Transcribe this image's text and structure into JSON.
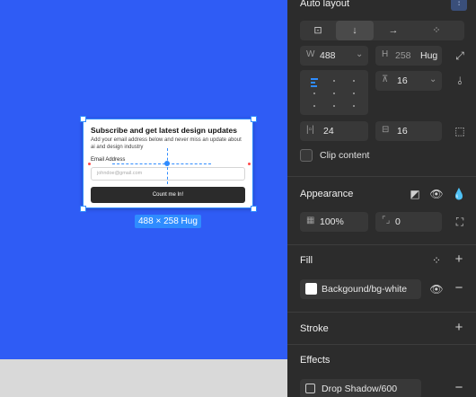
{
  "canvas": {
    "card": {
      "title": "Subscribe and get latest design updates",
      "description": "Add your email address below and never miss an update about ai and design industry",
      "email_label": "Email Address",
      "email_placeholder": "johndoe@gmail.com",
      "button_label": "Count me In!"
    },
    "size_badge": "488 × 258 Hug"
  },
  "panel": {
    "auto_layout": {
      "title": "Auto layout",
      "width_label": "W",
      "width_value": "488",
      "height_label": "H",
      "height_value": "258",
      "height_mode": "Hug",
      "gap": "16",
      "padding_horizontal": "24",
      "padding_vertical": "16",
      "clip_content_label": "Clip content"
    },
    "appearance": {
      "title": "Appearance",
      "opacity": "100%",
      "corner_radius": "0"
    },
    "fill": {
      "title": "Fill",
      "style_name": "Backgound/bg-white",
      "swatch_color": "#ffffff"
    },
    "stroke": {
      "title": "Stroke"
    },
    "effects": {
      "title": "Effects",
      "style_name": "Drop Shadow/600"
    }
  }
}
